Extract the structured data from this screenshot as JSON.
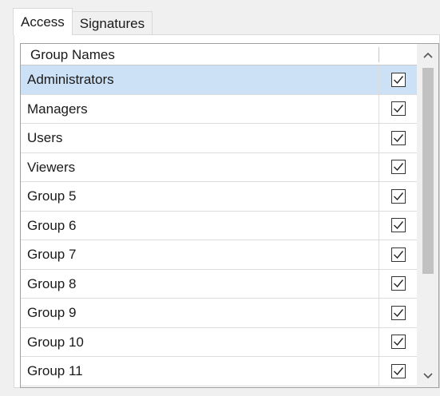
{
  "tabs": [
    {
      "label": "Access",
      "active": true
    },
    {
      "label": "Signatures",
      "active": false
    }
  ],
  "grid": {
    "columns": {
      "name": "Group Names",
      "checked": ""
    },
    "rows": [
      {
        "name": "Administrators",
        "checked": true,
        "selected": true
      },
      {
        "name": "Managers",
        "checked": true,
        "selected": false
      },
      {
        "name": "Users",
        "checked": true,
        "selected": false
      },
      {
        "name": "Viewers",
        "checked": true,
        "selected": false
      },
      {
        "name": "Group 5",
        "checked": true,
        "selected": false
      },
      {
        "name": "Group 6",
        "checked": true,
        "selected": false
      },
      {
        "name": "Group 7",
        "checked": true,
        "selected": false
      },
      {
        "name": "Group 8",
        "checked": true,
        "selected": false
      },
      {
        "name": "Group 9",
        "checked": true,
        "selected": false
      },
      {
        "name": "Group 10",
        "checked": true,
        "selected": false
      },
      {
        "name": "Group 11",
        "checked": true,
        "selected": false
      }
    ]
  },
  "scrollbar": {
    "up_icon": "chevron-up-icon",
    "down_icon": "chevron-down-icon"
  },
  "colors": {
    "selected_row": "#cce0f6",
    "border": "#a0a0a0",
    "thumb": "#c1c1c1"
  }
}
